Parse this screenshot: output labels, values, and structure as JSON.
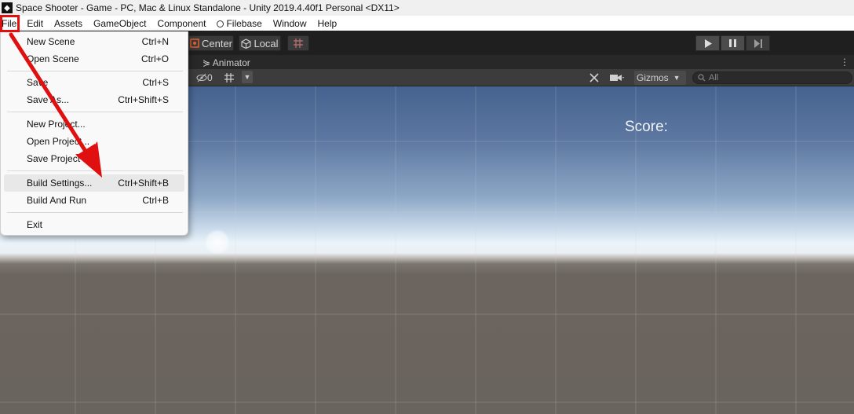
{
  "window": {
    "title": "Space Shooter - Game - PC, Mac & Linux Standalone - Unity 2019.4.40f1 Personal <DX11>"
  },
  "menubar": {
    "items": [
      "File",
      "Edit",
      "Assets",
      "GameObject",
      "Component",
      "Filebase",
      "Window",
      "Help"
    ]
  },
  "toolbar": {
    "pivot_label": "Center",
    "space_label": "Local",
    "play_icon": "play-icon",
    "pause_icon": "pause-icon",
    "step_icon": "step-icon"
  },
  "tabs": {
    "animator_label": "Animator",
    "more": "⋮"
  },
  "scene_toolbar": {
    "hidden_count": "0",
    "gizmos_label": "Gizmos",
    "search_placeholder": "All"
  },
  "viewport": {
    "score_label": "Score:"
  },
  "file_menu": {
    "items": [
      {
        "label": "New Scene",
        "shortcut": "Ctrl+N"
      },
      {
        "label": "Open Scene",
        "shortcut": "Ctrl+O"
      },
      {
        "label": "Save",
        "shortcut": "Ctrl+S"
      },
      {
        "label": "Save As...",
        "shortcut": "Ctrl+Shift+S"
      },
      {
        "label": "New Project...",
        "shortcut": ""
      },
      {
        "label": "Open Project...",
        "shortcut": ""
      },
      {
        "label": "Save Project",
        "shortcut": ""
      },
      {
        "label": "Build Settings...",
        "shortcut": "Ctrl+Shift+B"
      },
      {
        "label": "Build And Run",
        "shortcut": "Ctrl+B"
      },
      {
        "label": "Exit",
        "shortcut": ""
      }
    ]
  },
  "annotation": {
    "highlight_color": "#e01010"
  }
}
